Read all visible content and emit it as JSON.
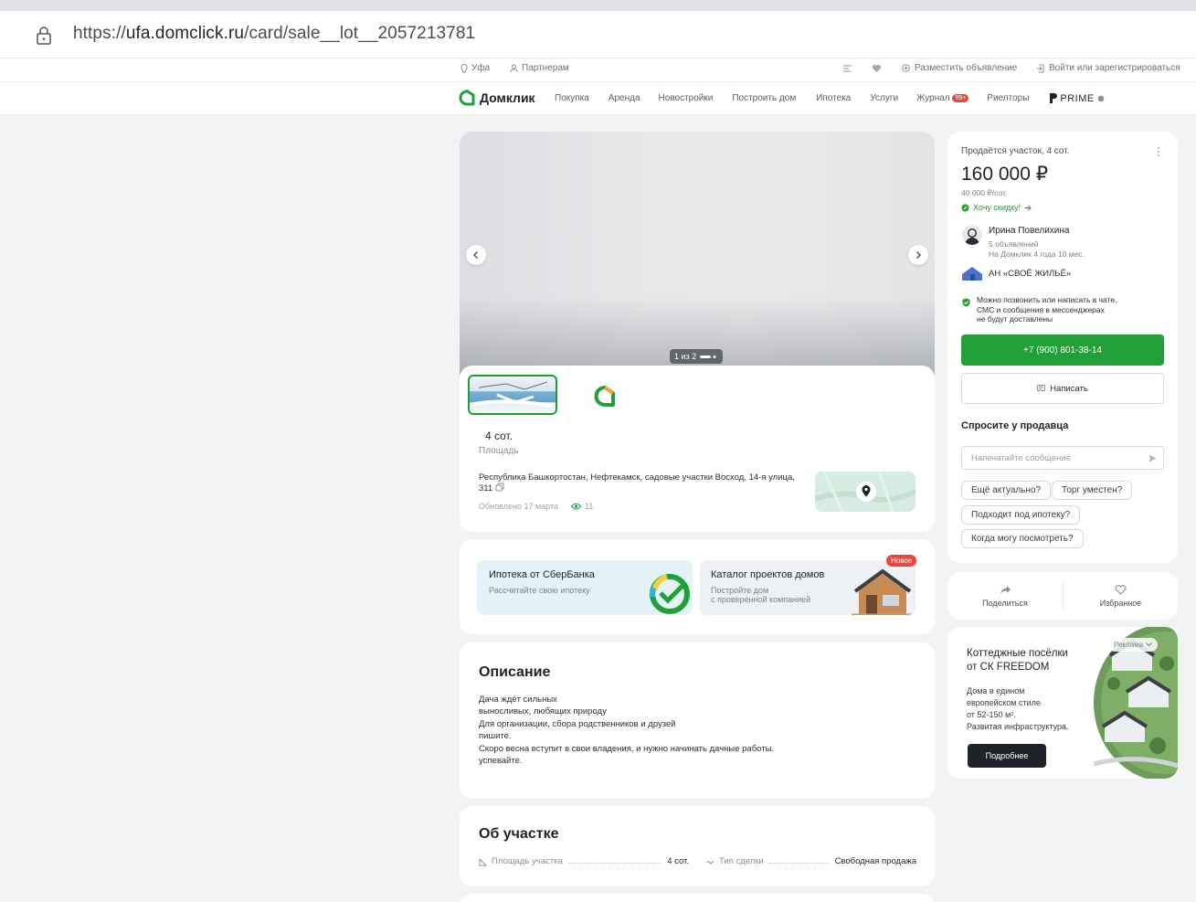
{
  "browser": {
    "url_scheme": "https://",
    "url_domain": "ufa.domclick.ru",
    "url_path": "/card/sale__lot__2057213781"
  },
  "topbar": {
    "city": "Уфа",
    "partners": "Партнерам",
    "post_ad": "Разместить объявление",
    "login": "Войти или зарегистрироваться"
  },
  "nav": {
    "logo": "Домклик",
    "items": [
      "Покупка",
      "Аренда",
      "Новостройки",
      "Построить дом",
      "Ипотека",
      "Услуги",
      "Журнал",
      "Риелторы"
    ],
    "journal_badge": "99+",
    "prime": "PRIME"
  },
  "gallery": {
    "counter": "1 из 2"
  },
  "listing": {
    "area_value": "4 сот.",
    "area_label": "Площадь",
    "address": "Республика Башкортостан, Нефтекамск, садовые участки Восход, 14-я улица, 311",
    "updated": "Обновлено 17 марта",
    "views": "11"
  },
  "promos": {
    "mortgage_title": "Ипотека от СберБанка",
    "mortgage_sub": "Рассчитайте свою ипотеку",
    "catalog_title": "Каталог проектов домов",
    "catalog_sub1": "Постройте дом",
    "catalog_sub2": "с проверенной компанией",
    "new_badge": "Новое"
  },
  "description": {
    "title": "Описание",
    "lines": [
      "Дача ждёт сильных",
      "выносливых, любящих природу",
      "Для организации, сбора родственников и друзей",
      "пишите.",
      "Скоро весна вступит в свои владения, и нужно начинать дачные работы.",
      "успевайте."
    ]
  },
  "plot": {
    "title": "Об участке",
    "area_label": "Площадь участка",
    "area_value": "4 сот.",
    "deal_label": "Тип сделки",
    "deal_value": "Свободная продажа"
  },
  "sidebar": {
    "kind": "Продаётся участок, 4 сот.",
    "price": "160 000 ₽",
    "price_per": "40 000 ₽/сот.",
    "discount": "Хочу скидку!",
    "seller_name": "Ирина Повелихина",
    "seller_ads": "5 объявлений",
    "seller_since": "На Домклик 4 года 10 мес.",
    "agency": "АН «СВОЁ ЖИЛЬЁ»",
    "notice1": "Можно позвонить или написать в чате,",
    "notice2": "СМС и сообщения в мессенджерах",
    "notice3": "не будут доставлены",
    "phone": "+7 (900) 801-38-14",
    "write": "Написать",
    "ask_title": "Спросите у продавца",
    "input_placeholder": "Напечатайте сообщение",
    "chips": [
      "Ещё актуально?",
      "Торг уместен?",
      "Подходит под ипотеку?",
      "Когда могу посмотреть?"
    ],
    "share": "Поделиться",
    "favorite": "Избранное"
  },
  "ad": {
    "label": "Реклама",
    "title1": "Коттеджные посёлки",
    "title2": "от СК FREEDOM",
    "l1": "Дома в едином",
    "l2": "европейском стиле",
    "l3": "от 52-150 м².",
    "l4": "Развитая инфраструктура.",
    "button": "Подробнее"
  },
  "colors": {
    "brand_green": "#21a038",
    "accent_red": "#e8473d"
  }
}
